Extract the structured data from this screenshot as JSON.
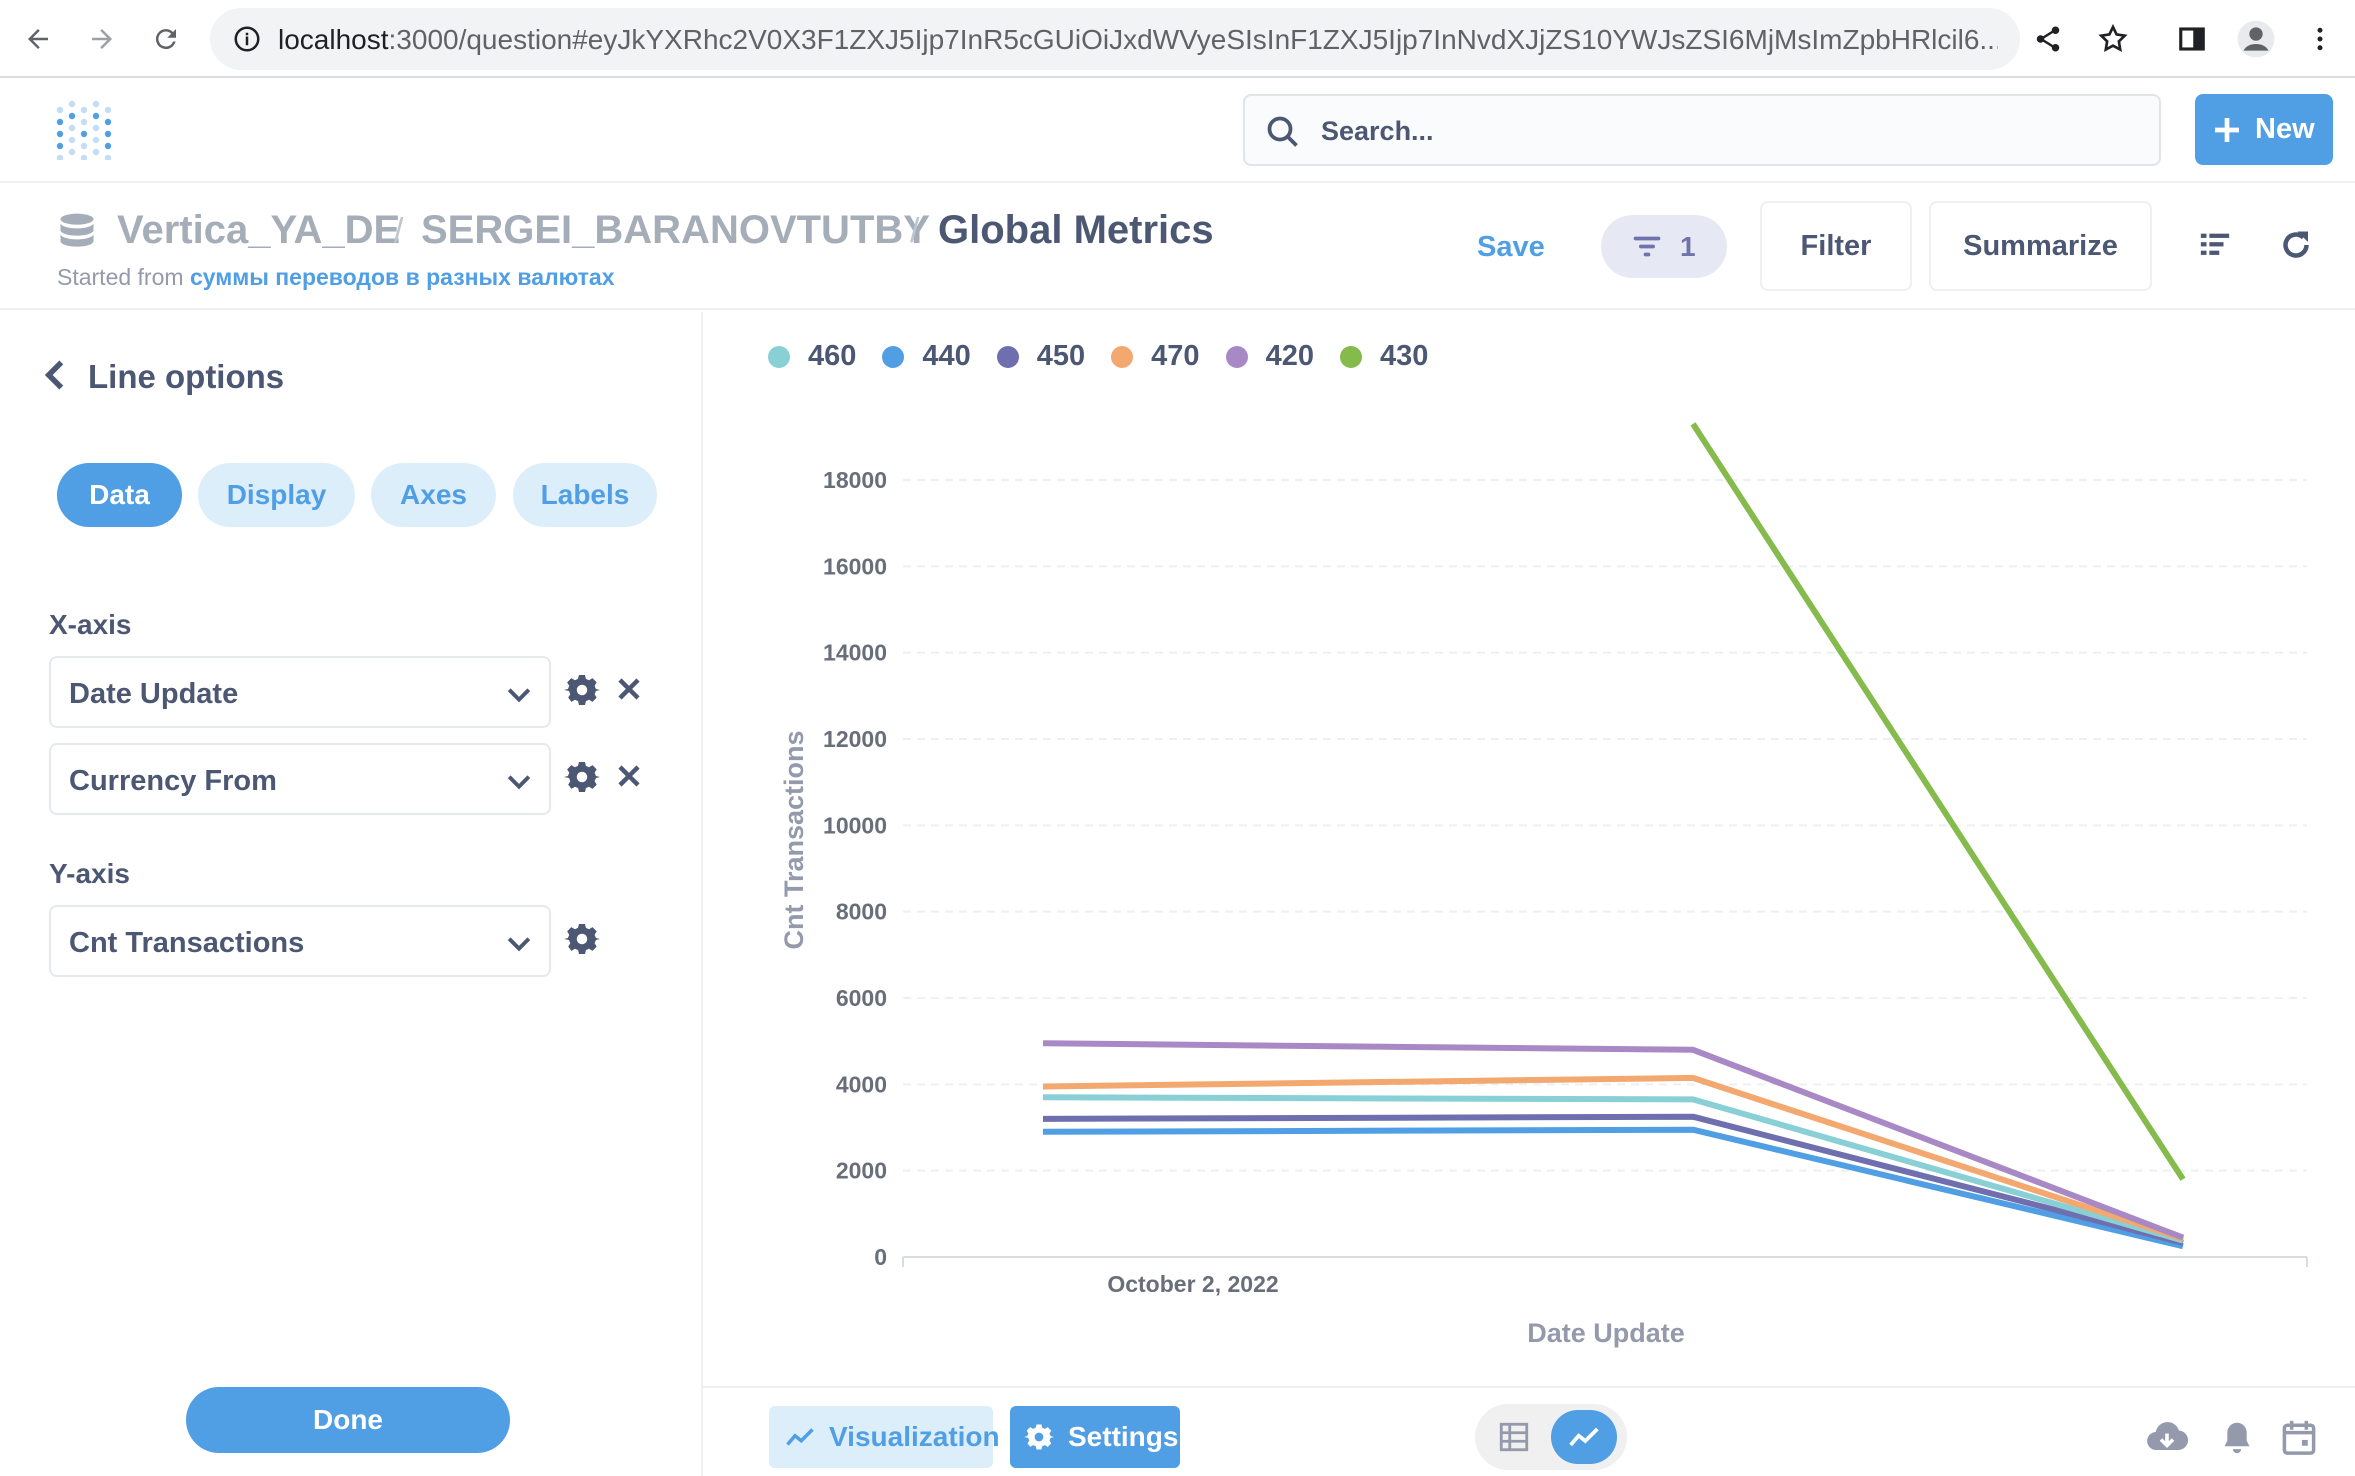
{
  "browser": {
    "url_host": "localhost",
    "url_rest": ":3000/question#eyJkYXRhc2V0X3F1ZXJ5Ijp7InR5cGUiOiJxdWVyeSIsInF1ZXJ5Ijp7InNvdXJjZS10YWJsZSI6MjMsImZpbHRlcil6..."
  },
  "nav": {
    "search_placeholder": "Search...",
    "new_label": "New"
  },
  "header": {
    "database": "Vertica_YA_DE",
    "schema": "SERGEI_BARANOVTUTBY",
    "title": "Global Metrics",
    "started_prefix": "Started from",
    "started_link": "суммы переводов в разных валютах",
    "save_label": "Save",
    "filter_count": "1",
    "filter_label": "Filter",
    "summarize_label": "Summarize"
  },
  "sidebar": {
    "title": "Line options",
    "tabs": [
      {
        "label": "Data",
        "active": true
      },
      {
        "label": "Display",
        "active": false
      },
      {
        "label": "Axes",
        "active": false
      },
      {
        "label": "Labels",
        "active": false
      }
    ],
    "x_axis_label": "X-axis",
    "x_fields": [
      "Date Update",
      "Currency From"
    ],
    "y_axis_label": "Y-axis",
    "y_fields": [
      "Cnt Transactions"
    ],
    "done_label": "Done"
  },
  "footer": {
    "visualization_label": "Visualization",
    "settings_label": "Settings"
  },
  "chart_data": {
    "type": "line",
    "xlabel": "Date Update",
    "ylabel": "Cnt Transactions",
    "x_tick_labels": [
      "October 2, 2022"
    ],
    "ylim": [
      0,
      18000
    ],
    "y_ticks": [
      0,
      2000,
      4000,
      6000,
      8000,
      10000,
      12000,
      14000,
      16000,
      18000
    ],
    "grid": true,
    "legend_position": "top-left",
    "x": [
      0,
      1,
      2
    ],
    "series": [
      {
        "name": "460",
        "color": "#88d0d5",
        "values": [
          3700,
          3650,
          380
        ]
      },
      {
        "name": "440",
        "color": "#509ee3",
        "values": [
          2900,
          2950,
          250
        ]
      },
      {
        "name": "450",
        "color": "#6f6fb0",
        "values": [
          3200,
          3250,
          330
        ]
      },
      {
        "name": "470",
        "color": "#f2a86f",
        "values": [
          3950,
          4150,
          420
        ]
      },
      {
        "name": "420",
        "color": "#a989c5",
        "values": [
          4950,
          4800,
          450
        ]
      },
      {
        "name": "430",
        "color": "#84bb4c",
        "values": [
          null,
          19300,
          1800
        ]
      }
    ]
  }
}
